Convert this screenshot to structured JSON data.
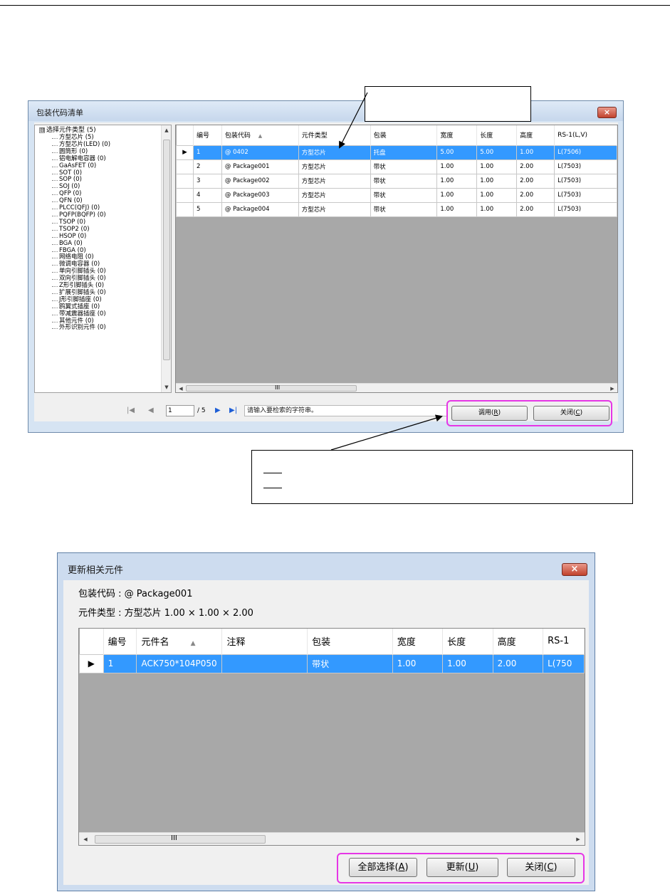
{
  "window1": {
    "title": "包装代码清单",
    "close_label": "×",
    "tree": {
      "root_toggle": "⊟",
      "root": "选择元件类型 (5)",
      "items": [
        "方型芯片 (5)",
        "方型芯片(LED) (0)",
        "圆筒形 (0)",
        "铝电解电容器 (0)",
        "GaAsFET (0)",
        "SOT (0)",
        "SOP (0)",
        "SOJ (0)",
        "QFP (0)",
        "QFN (0)",
        "PLCC(QFJ) (0)",
        "PQFP(BQFP) (0)",
        "TSOP (0)",
        "TSOP2 (0)",
        "HSOP (0)",
        "BGA (0)",
        "FBGA (0)",
        "网络电阻 (0)",
        "微调电容器 (0)",
        "单向引脚插头 (0)",
        "双向引脚插头 (0)",
        "Z形引脚插头 (0)",
        "扩展引脚插头 (0)",
        "J形引脚插座 (0)",
        "鸥翼式插座 (0)",
        "带减震器插座 (0)",
        "其他元件 (0)",
        "外形识别元件 (0)"
      ]
    },
    "grid": {
      "columns": [
        "编号",
        "包装代码",
        "元件类型",
        "包装",
        "宽度",
        "长度",
        "高度",
        "RS-1(L,V)"
      ],
      "sort_indicator": "▲",
      "rows": [
        [
          "1",
          "@ 0402",
          "方型芯片",
          "托盘",
          "5.00",
          "5.00",
          "1.00",
          "L(7506)"
        ],
        [
          "2",
          "@ Package001",
          "方型芯片",
          "带状",
          "1.00",
          "1.00",
          "2.00",
          "L(7503)"
        ],
        [
          "3",
          "@ Package002",
          "方型芯片",
          "带状",
          "1.00",
          "1.00",
          "2.00",
          "L(7503)"
        ],
        [
          "4",
          "@ Package003",
          "方型芯片",
          "带状",
          "1.00",
          "1.00",
          "2.00",
          "L(7503)"
        ],
        [
          "5",
          "@ Package004",
          "方型芯片",
          "带状",
          "1.00",
          "1.00",
          "2.00",
          "L(7503)"
        ]
      ],
      "selected_row": 0,
      "scroll_grip": "III"
    },
    "nav": {
      "first": "|◀",
      "prev": "◀",
      "page": "1",
      "total": "/ 5",
      "next": "▶",
      "last": "▶|",
      "search_hint": "请输入要检索的字符串。"
    },
    "buttons": {
      "call": "调用(",
      "call_key": "R",
      "close": "关闭(",
      "close_key": "C"
    }
  },
  "window2": {
    "title": "更新相关元件",
    "close_label": "×",
    "package_code": "包装代码 : @ Package001",
    "component_type": "元件类型 : 方型芯片   1.00 × 1.00 × 2.00",
    "grid": {
      "columns": [
        "编号",
        "元件名",
        "注释",
        "包装",
        "宽度",
        "长度",
        "高度",
        "RS-1"
      ],
      "sort_indicator": "▲",
      "rows": [
        [
          "1",
          "ACK750*104P050",
          "",
          "带状",
          "1.00",
          "1.00",
          "2.00",
          "L(750"
        ]
      ],
      "scroll_grip": "III"
    },
    "buttons": {
      "select_all": "全部选择(",
      "select_all_key": "A",
      "update": "更新(",
      "update_key": "U",
      "close": "关闭(",
      "close_key": "C"
    }
  },
  "row_pointer": "▶"
}
